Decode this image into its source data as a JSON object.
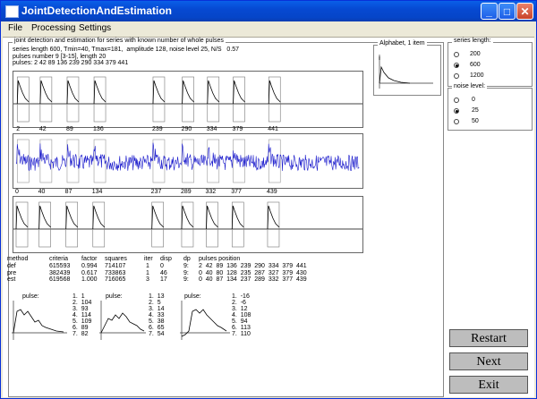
{
  "window": {
    "title": "JointDetectionAndEstimation"
  },
  "menu": [
    "File",
    "Processing",
    "Settings"
  ],
  "main_group": {
    "title": "joint detection and estimation for series with known number of whole pulses",
    "info": [
      "series length 600, Tmin=40, Tmax=181,  amplitude 128, noise level 25, N/S   0.57",
      "pulses number 9 [3-15], length 20",
      "pulses: 2 42 89 136 239 290 334 379 441"
    ]
  },
  "alphabet": {
    "title": "Alphabet, 1 item"
  },
  "series_length": {
    "title": "series length:",
    "options": [
      "200",
      "600",
      "1200"
    ],
    "selected": 1
  },
  "noise_level": {
    "title": "noise level:",
    "options": [
      "0",
      "25",
      "50"
    ],
    "selected": 1
  },
  "axis_labels": {
    "top": [
      "2",
      "42",
      "89",
      "136",
      "239",
      "290",
      "334",
      "379",
      "441"
    ],
    "bottom": [
      "0",
      "40",
      "87",
      "134",
      "237",
      "289",
      "332",
      "377",
      "439"
    ]
  },
  "results_table": {
    "headers": [
      "method",
      "criteria",
      "factor",
      "squares",
      "iter",
      "disp",
      "dp",
      "pulses position"
    ],
    "rows": [
      [
        "def",
        "615593",
        "0.994",
        "714107",
        "1",
        "0",
        "9:",
        "2  42  89  136  239  290  334  379  441"
      ],
      [
        "pre",
        "382439",
        "0.617",
        "733863",
        "1",
        "46",
        "9:",
        "0  40  80  128  235  287  327  379  430"
      ],
      [
        "est",
        "619568",
        "1.000",
        "716065",
        "3",
        "17",
        "9:",
        "0  40  87  134  237  289  332  377  439"
      ]
    ]
  },
  "pulse_panels": [
    {
      "label": "pulse:",
      "values": [
        "1.  1",
        "2.  104",
        "3.  93",
        "4.  114",
        "5.  109",
        "6.  89",
        "7.  82"
      ]
    },
    {
      "label": "pulse:",
      "values": [
        "1.  13",
        "2.  5",
        "3.  14",
        "4.  33",
        "5.  38",
        "6.  65",
        "7.  54"
      ]
    },
    {
      "label": "pulse:",
      "values": [
        "1.  -16",
        "2.  -6",
        "3.  12",
        "4.  108",
        "5.  94",
        "6.  113",
        "7.  110"
      ]
    }
  ],
  "buttons": {
    "restart": "Restart",
    "next": "Next",
    "exit": "Exit"
  }
}
